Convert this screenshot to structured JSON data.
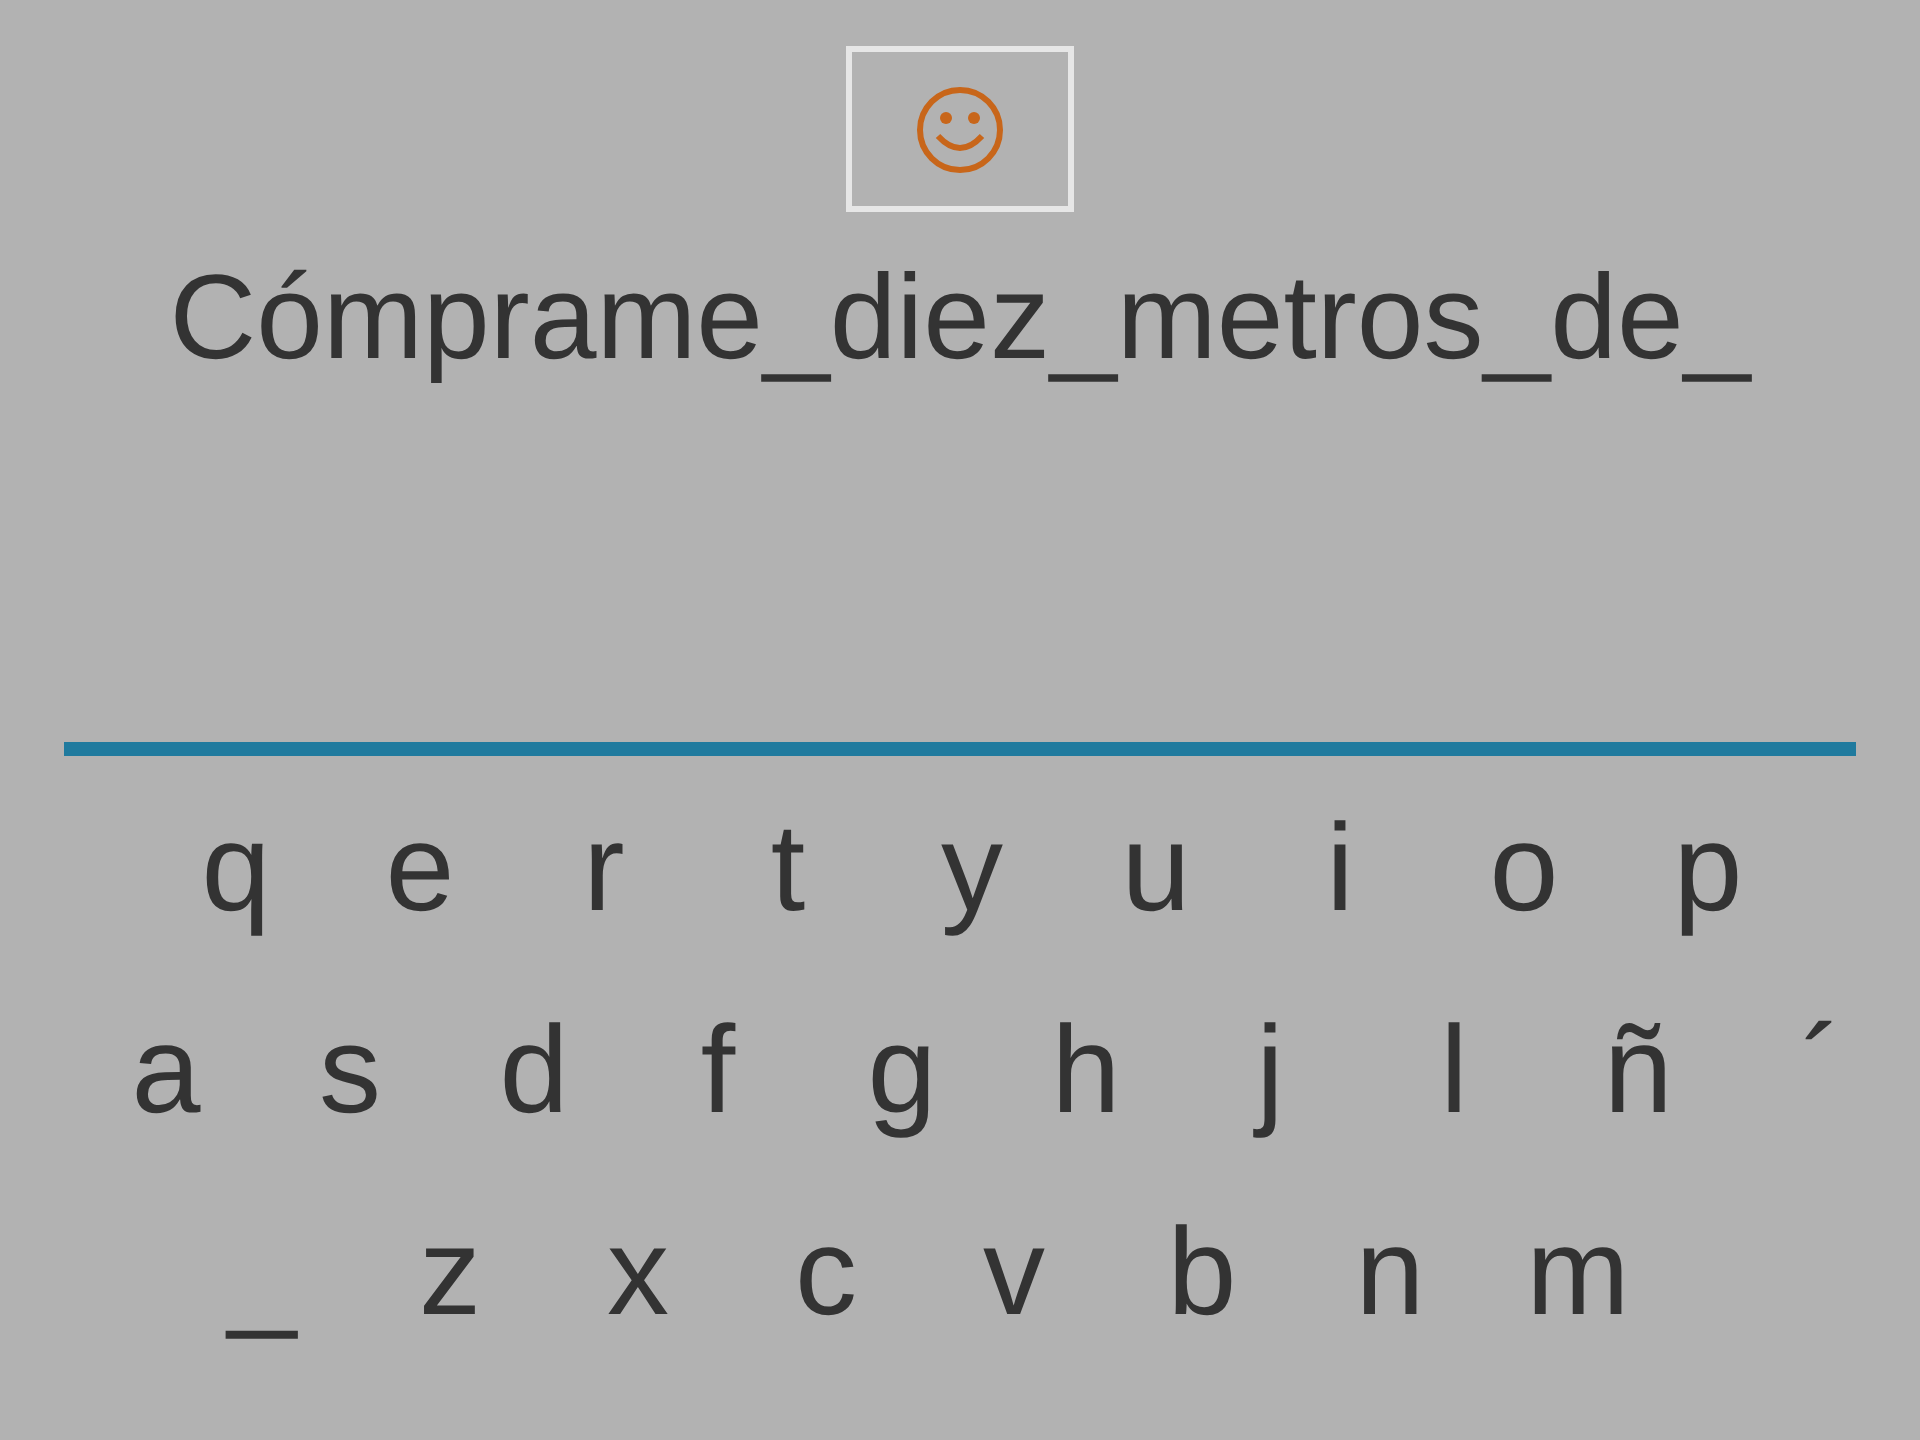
{
  "sentence": "Cómprame_diez_metros_de_",
  "keyboard": {
    "rows": [
      [
        "q",
        "e",
        "r",
        "t",
        "y",
        "u",
        "i",
        "o",
        "p"
      ],
      [
        "a",
        "s",
        "d",
        "f",
        "g",
        "h",
        "j",
        "l",
        "ñ",
        "´"
      ],
      [
        "_",
        "z",
        "x",
        "c",
        "v",
        "b",
        "n",
        "m"
      ]
    ]
  }
}
